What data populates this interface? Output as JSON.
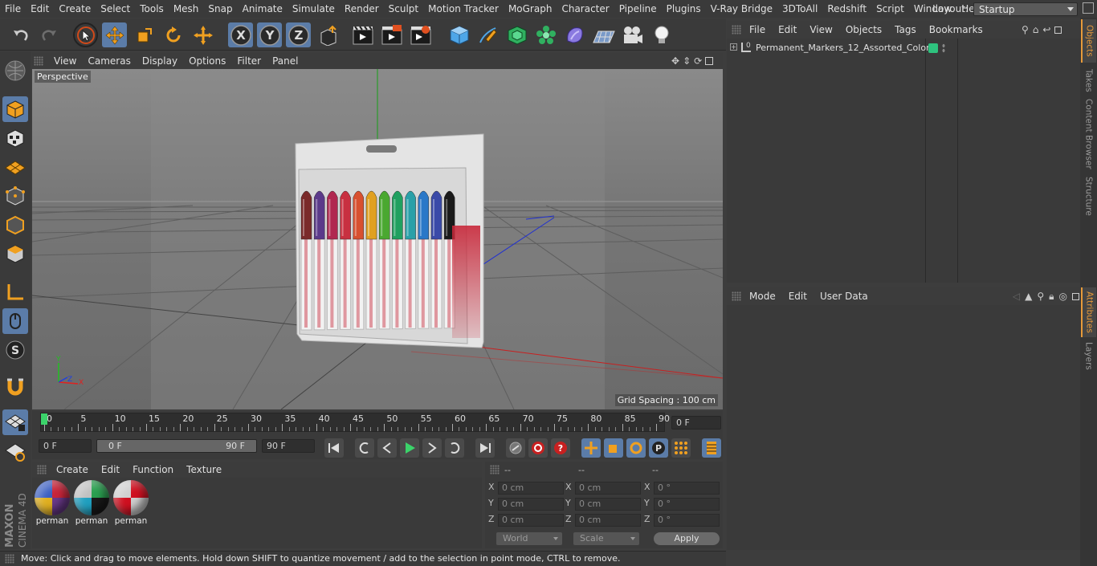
{
  "menubar": {
    "items": [
      "File",
      "Edit",
      "Create",
      "Select",
      "Tools",
      "Mesh",
      "Snap",
      "Animate",
      "Simulate",
      "Render",
      "Sculpt",
      "Motion Tracker",
      "MoGraph",
      "Character",
      "Pipeline",
      "Plugins",
      "V-Ray Bridge",
      "3DToAll",
      "Redshift",
      "Script",
      "Window",
      "Help"
    ],
    "layout_label": "Layout:",
    "layout_value": "Startup"
  },
  "toolbar": {
    "icons": [
      "undo-icon",
      "redo-icon",
      "live-selection-icon",
      "move-icon",
      "scale-icon",
      "rotate-icon",
      "transform-icon",
      "x-axis-icon",
      "y-axis-icon",
      "z-axis-icon",
      "coordinate-system-icon",
      "render-view-icon",
      "render-picture-viewer-icon",
      "render-settings-icon",
      "cube-icon",
      "pen-icon",
      "subdivision-icon",
      "cloner-icon",
      "deformer-icon",
      "floor-icon",
      "camera-icon",
      "light-icon"
    ]
  },
  "viewport": {
    "menu": [
      "View",
      "Cameras",
      "Display",
      "Options",
      "Filter",
      "Panel"
    ],
    "camera_label": "Perspective",
    "grid_spacing": "Grid Spacing : 100 cm"
  },
  "timeline": {
    "ticks": [
      "0",
      "5",
      "10",
      "15",
      "20",
      "25",
      "30",
      "35",
      "40",
      "45",
      "50",
      "55",
      "60",
      "65",
      "70",
      "75",
      "80",
      "85",
      "90"
    ],
    "current_frame": "0 F"
  },
  "playbar": {
    "start_frame": "0 F",
    "range_start": "0 F",
    "range_end": "90 F",
    "end_frame": "90 F"
  },
  "materials": {
    "menu": [
      "Create",
      "Edit",
      "Function",
      "Texture"
    ],
    "items": [
      {
        "label": "perman",
        "colors": [
          "#c8253a",
          "#6a3a8a",
          "#e0b020",
          "#3a5ec0"
        ]
      },
      {
        "label": "perman",
        "colors": [
          "#2aa050",
          "#1a1a1a",
          "#20a0c0",
          "#c0c0c0"
        ]
      },
      {
        "label": "perman",
        "colors": [
          "#d01020",
          "#d0d0d0",
          "#d01020",
          "#d0d0d0"
        ]
      }
    ]
  },
  "coordinates": {
    "headers": [
      "--",
      "--",
      "--"
    ],
    "rows": [
      {
        "axis": "X",
        "pos": "0 cm",
        "size": "0 cm",
        "rot_axis": "X",
        "rot": "0 °"
      },
      {
        "axis": "Y",
        "pos": "0 cm",
        "size": "0 cm",
        "rot_axis": "Y",
        "rot": "0 °"
      },
      {
        "axis": "Z",
        "pos": "0 cm",
        "size": "0 cm",
        "rot_axis": "Z",
        "rot": "0 °"
      }
    ],
    "mode": "World",
    "size_mode": "Scale",
    "apply": "Apply"
  },
  "status": "Move: Click and drag to move elements. Hold down SHIFT to quantize movement / add to the selection in point mode, CTRL to remove.",
  "objects": {
    "menu": [
      "File",
      "Edit",
      "View",
      "Objects",
      "Tags",
      "Bookmarks"
    ],
    "items": [
      {
        "name": "Permanent_Markers_12_Assorted_Colors",
        "layer_color": "#2ec27e"
      }
    ]
  },
  "attributes": {
    "menu": [
      "Mode",
      "Edit",
      "User Data"
    ]
  },
  "side_tabs": [
    "Objects",
    "Takes",
    "Content Browser",
    "Structure",
    "Attributes",
    "Layers"
  ],
  "brand": {
    "maker": "MAXON",
    "product": "CINEMA 4D"
  },
  "marker_colors": [
    "#7a2a2a",
    "#5b3a8a",
    "#b02850",
    "#c83040",
    "#d85030",
    "#e0a020",
    "#4aa830",
    "#20a060",
    "#2aa0a8",
    "#2a78c8",
    "#3a4aa8",
    "#1a1a1a"
  ]
}
